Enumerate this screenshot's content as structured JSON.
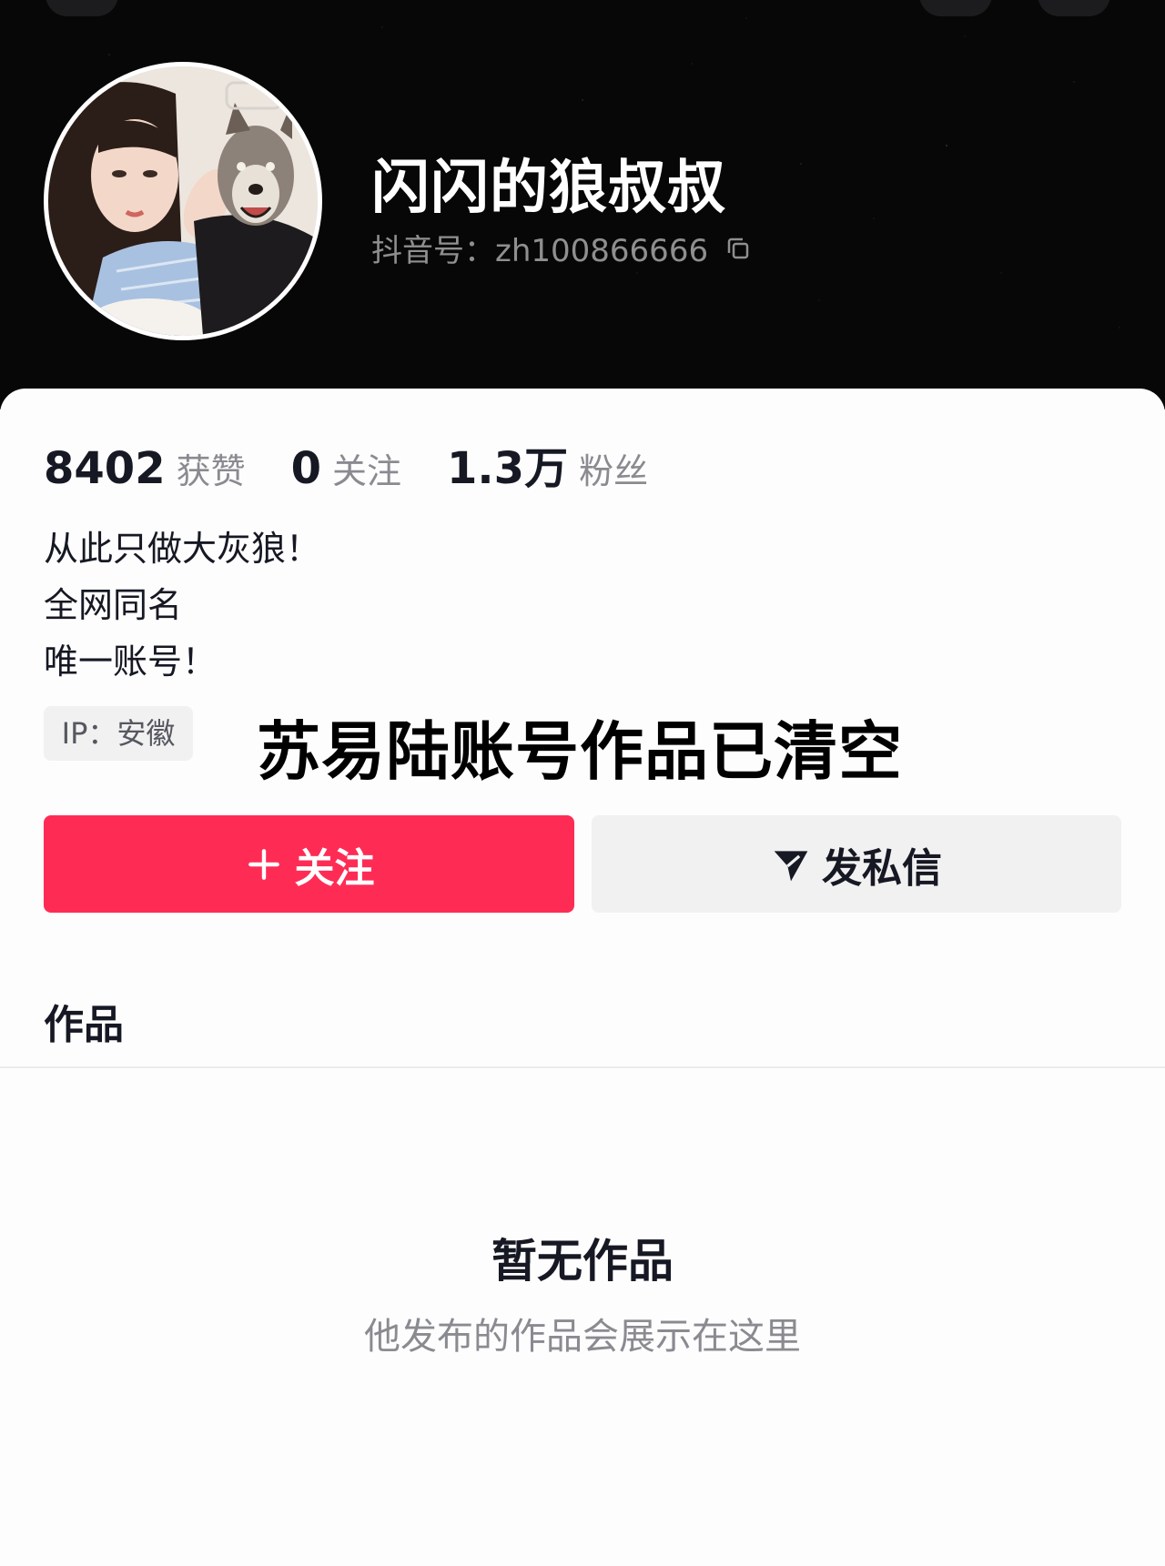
{
  "profile": {
    "nickname": "闪闪的狼叔叔",
    "douyin_id": "抖音号：zh100866666"
  },
  "stats": [
    {
      "value": "8402",
      "label": "获赞"
    },
    {
      "value": "0",
      "label": "关注"
    },
    {
      "value": "1.3万",
      "label": "粉丝"
    }
  ],
  "bio": [
    "从此只做大灰狼！",
    "全网同名",
    "唯一账号！"
  ],
  "ip_tag": "IP：安徽",
  "overlay_caption": "苏易陆账号作品已清空",
  "actions": {
    "follow_label": "关注",
    "message_label": "发私信"
  },
  "tabs": {
    "works": "作品"
  },
  "empty_state": {
    "title": "暂无作品",
    "subtitle": "他发布的作品会展示在这里"
  },
  "colors": {
    "accent": "#fe2c55",
    "header_bg": "#070707",
    "secondary_btn": "#f1f1f2",
    "muted_text": "#8a8b91"
  }
}
